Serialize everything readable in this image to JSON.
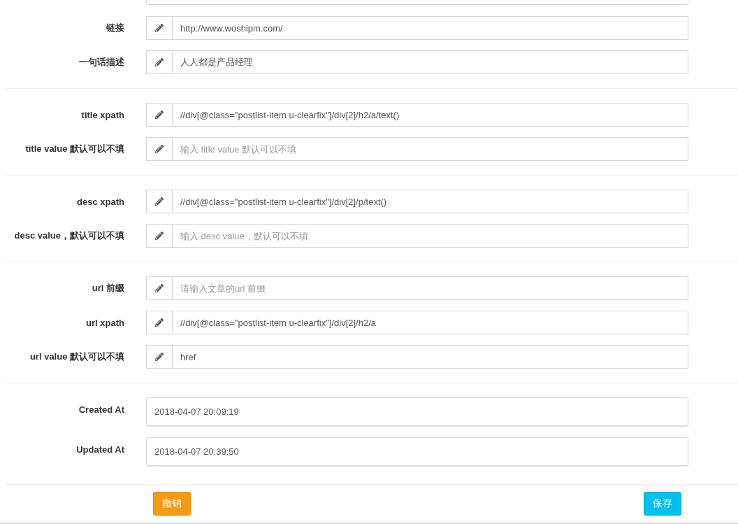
{
  "sections": [
    {
      "fields": [
        {
          "kind": "icon",
          "label": "链接",
          "value": "http://www.woshipm.com/"
        },
        {
          "kind": "icon",
          "label": "一句话描述",
          "value": "人人都是产品经理"
        }
      ]
    },
    {
      "fields": [
        {
          "kind": "icon",
          "label": "title xpath",
          "value": "//div[@class=\"postlist-item u-clearfix\"]/div[2]/h2/a/text()"
        },
        {
          "kind": "icon",
          "label": "title value 默认可以不填",
          "placeholder": "输入 title value 默认可以不填"
        }
      ]
    },
    {
      "fields": [
        {
          "kind": "icon",
          "label": "desc xpath",
          "value": "//div[@class=\"postlist-item u-clearfix\"]/div[2]/p/text()"
        },
        {
          "kind": "icon",
          "label": "desc value，默认可以不填",
          "placeholder": "输入 desc value，默认可以不填"
        }
      ]
    },
    {
      "fields": [
        {
          "kind": "icon",
          "label": "url 前缀",
          "placeholder": "请输入文章的url 前缀"
        },
        {
          "kind": "icon",
          "label": "url xpath",
          "value": "//div[@class=\"postlist-item u-clearfix\"]/div[2]/h2/a"
        },
        {
          "kind": "icon",
          "label": "url value 默认可以不填",
          "value": "href"
        }
      ]
    },
    {
      "fields": [
        {
          "kind": "plain",
          "label": "Created At",
          "value": "2018-04-07 20:09:19"
        },
        {
          "kind": "plain",
          "label": "Updated At",
          "value": "2018-04-07 20:39:50"
        }
      ]
    }
  ],
  "buttons": [
    {
      "kind": "cancel",
      "label": "撤销"
    },
    {
      "kind": "save",
      "label": "保存"
    }
  ]
}
